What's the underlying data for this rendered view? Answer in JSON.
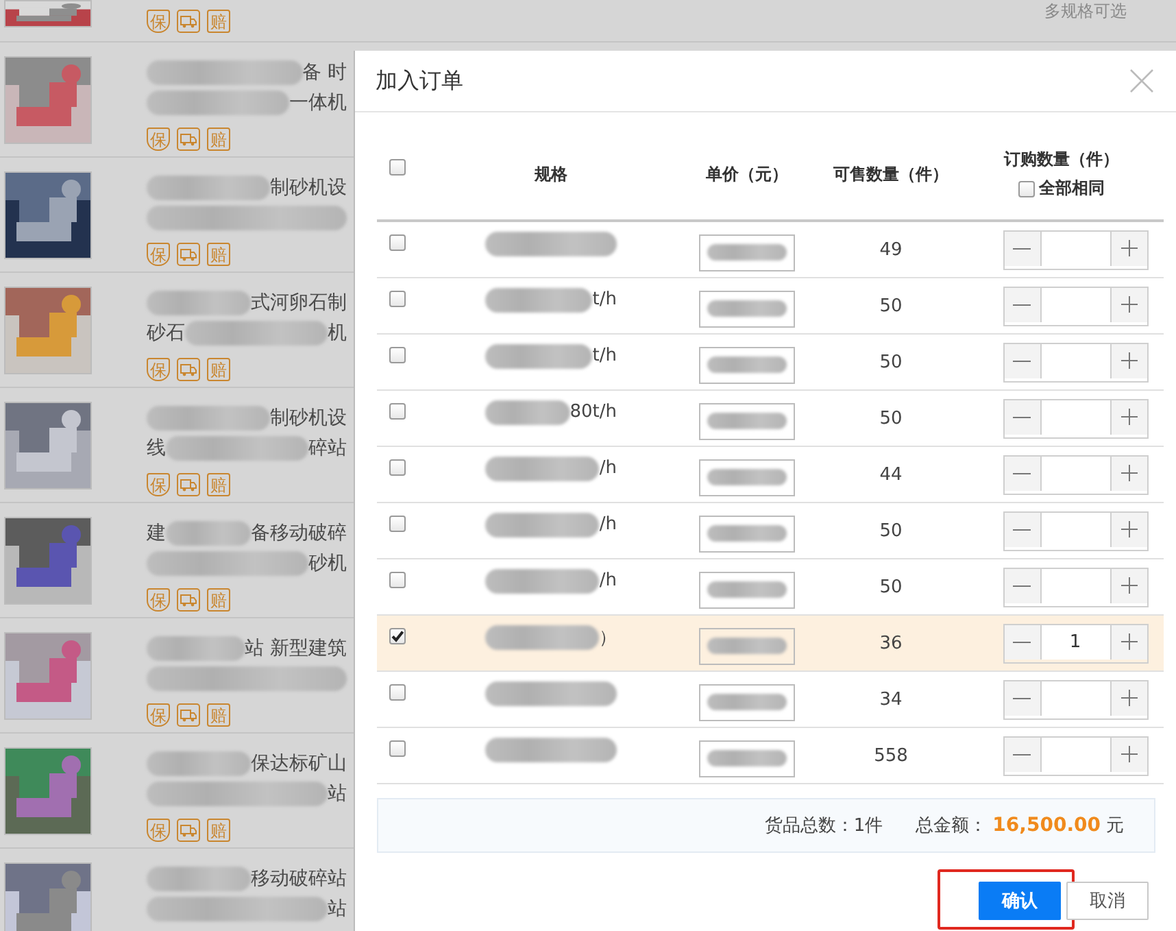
{
  "background_list": {
    "items": [
      {
        "badges": [
          "保",
          "赔"
        ],
        "aside": "多规格可选",
        "cut": true
      },
      {
        "title_lines": [
          [
            {
              "kind": "blur"
            },
            {
              "kind": "text",
              "text": "备 时"
            }
          ],
          [
            {
              "kind": "blur"
            },
            {
              "kind": "text",
              "text": "一体机"
            }
          ]
        ],
        "badges": [
          "保",
          "赔"
        ]
      },
      {
        "title_lines": [
          [
            {
              "kind": "blur"
            },
            {
              "kind": "text",
              "text": "制砂机设"
            }
          ],
          [
            {
              "kind": "blur"
            }
          ]
        ],
        "badges": [
          "保",
          "赔"
        ]
      },
      {
        "title_lines": [
          [
            {
              "kind": "blur"
            },
            {
              "kind": "text",
              "text": "式河卵石制"
            }
          ],
          [
            {
              "kind": "text",
              "text": "砂石"
            },
            {
              "kind": "blur"
            },
            {
              "kind": "text",
              "text": "机"
            }
          ]
        ],
        "badges": [
          "保",
          "赔"
        ]
      },
      {
        "title_lines": [
          [
            {
              "kind": "blur"
            },
            {
              "kind": "text",
              "text": "制砂机设"
            }
          ],
          [
            {
              "kind": "text",
              "text": "线"
            },
            {
              "kind": "blur"
            },
            {
              "kind": "text",
              "text": "碎站"
            }
          ]
        ],
        "badges": [
          "保",
          "赔"
        ]
      },
      {
        "title_lines": [
          [
            {
              "kind": "text",
              "text": "建"
            },
            {
              "kind": "blur"
            },
            {
              "kind": "text",
              "text": "备移动破碎"
            }
          ],
          [
            {
              "kind": "blur"
            },
            {
              "kind": "text",
              "text": "砂机"
            }
          ]
        ],
        "badges": [
          "保",
          "赔"
        ]
      },
      {
        "title_lines": [
          [
            {
              "kind": "blur"
            },
            {
              "kind": "text",
              "text": "站 新型建筑"
            }
          ],
          [
            {
              "kind": "blur"
            }
          ]
        ],
        "badges": [
          "保",
          "赔"
        ]
      },
      {
        "title_lines": [
          [
            {
              "kind": "blur"
            },
            {
              "kind": "text",
              "text": "保达标矿山"
            }
          ],
          [
            {
              "kind": "blur"
            },
            {
              "kind": "text",
              "text": "站"
            }
          ]
        ],
        "badges": [
          "保",
          "赔"
        ]
      },
      {
        "title_lines": [
          [
            {
              "kind": "blur"
            },
            {
              "kind": "text",
              "text": "移动破碎站"
            }
          ],
          [
            {
              "kind": "blur"
            },
            {
              "kind": "text",
              "text": "站"
            }
          ]
        ]
      }
    ]
  },
  "dialog": {
    "title": "加入订单",
    "columns": {
      "select_all": {
        "checked": false
      },
      "spec": "规格",
      "price": "单价（元）",
      "available": "可售数量（件）",
      "quantity": "订购数量（件）",
      "same_for_all": {
        "label": "全部相同",
        "checked": false
      }
    },
    "rows": [
      {
        "checked": false,
        "available": "49"
      },
      {
        "checked": false,
        "spec_tail": "t/h",
        "available": "50"
      },
      {
        "checked": false,
        "spec_tail": "t/h",
        "available": "50"
      },
      {
        "checked": false,
        "spec_tail": "80t/h",
        "available": "50"
      },
      {
        "checked": false,
        "spec_tail": "/h",
        "available": "44"
      },
      {
        "checked": false,
        "spec_tail": "/h",
        "available": "50"
      },
      {
        "checked": false,
        "spec_tail": "/h",
        "available": "50"
      },
      {
        "checked": true,
        "spec_tail": "）",
        "available": "36",
        "quantity": "1"
      },
      {
        "checked": false,
        "available": "34"
      },
      {
        "checked": false,
        "available": "558"
      }
    ],
    "summary": {
      "count_label": "货品总数：1件",
      "total_label": "总金额：",
      "total_value": "16,500.00",
      "currency": "元"
    },
    "buttons": [
      {
        "kind": "primary",
        "label": "确认",
        "highlighted": true
      },
      {
        "kind": "secondary",
        "label": "取消",
        "highlighted": false
      }
    ]
  }
}
